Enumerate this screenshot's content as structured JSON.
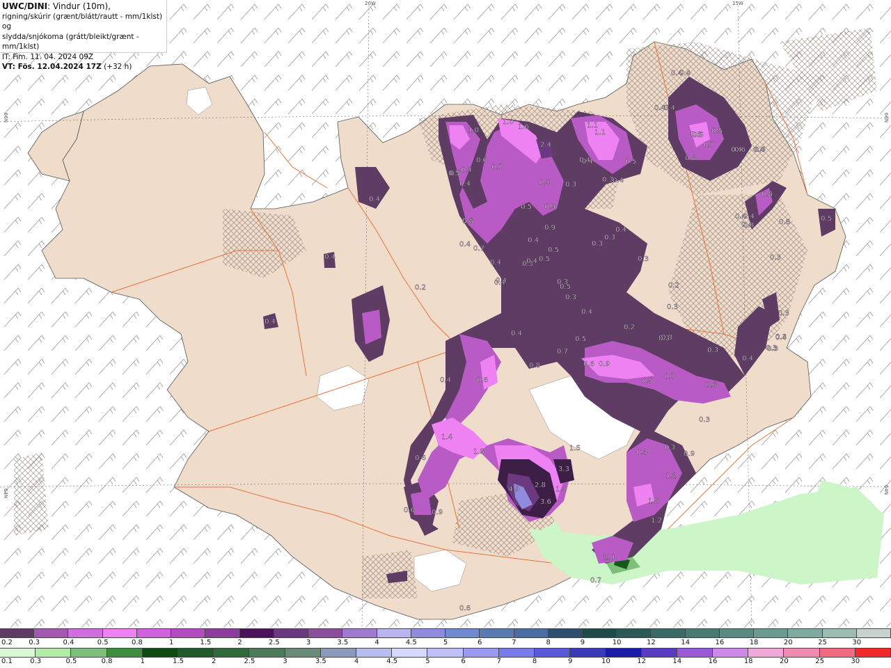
{
  "title": {
    "model": "UWC/DINI",
    "line1": ": Vindur (10m),",
    "line2": "rigning/skúrir (grænt/blátt/rautt - mm/1klst) og",
    "line3": "slydda/snjókoma (grátt/bleikt/grænt - mm/1klst)",
    "it": "IT: Fim. 11. 04. 2024 09Z",
    "vt_label": "VT: Fös. 12.04.2024 17Z",
    "vt_offset": " (+32 h)"
  },
  "grid_labels": {
    "top_20w": "20W",
    "top_15w": "15W",
    "left_66n": "66N",
    "right_66n": "66N",
    "left_64n": "64N",
    "right_64n": "64N"
  },
  "colors": {
    "land": "#efdccb",
    "sea": "#ffffff",
    "roads": "#e8743c",
    "wind_barbs": "#8a8a8a",
    "snow_light": "#5e3c63",
    "snow_mid": "#b95bc4",
    "snow_bright": "#ee82f2",
    "snow_heavy": "#3c1e47",
    "snow_peak": "#8f8ce0",
    "rain_light": "#ccf5c8",
    "rain_mid": "#7dbf7b",
    "rain_heavy": "#14581a"
  },
  "snow_scale": {
    "labels": [
      "0.2",
      "0.3",
      "0.4",
      "0.5",
      "0.8",
      "1",
      "1.5",
      "2",
      "2.5",
      "3",
      "3.5",
      "4",
      "4.5",
      "5",
      "6",
      "7",
      "8",
      "9",
      "10",
      "12",
      "14",
      "16",
      "18",
      "20",
      "25",
      "30"
    ],
    "colors": [
      "#5e3c63",
      "#a15ab0",
      "#d06ee0",
      "#ee82f2",
      "#d060de",
      "#b24cc0",
      "#8c3c9c",
      "#4a1058",
      "#6b3a7e",
      "#8a4f9a",
      "#a07ad0",
      "#b9b3ee",
      "#8f8ce0",
      "#6f8ad0",
      "#5a7ab2",
      "#4b6ca0",
      "#2e4e6e",
      "#1f4a4a",
      "#2b5a56",
      "#3a6a66",
      "#4a7a74",
      "#5a8a82",
      "#6a9a90",
      "#80aaa0",
      "#9cbbb2",
      "#c8d2cf"
    ]
  },
  "rain_scale": {
    "labels": [
      "0.1",
      "0.3",
      "0.5",
      "0.8",
      "1",
      "1.5",
      "2",
      "2.5",
      "3",
      "3.5",
      "4",
      "4.5",
      "5",
      "6",
      "7",
      "8",
      "9",
      "10",
      "12",
      "14",
      "16",
      "18",
      "20",
      "25",
      "30"
    ],
    "colors": [
      "#d9f8d4",
      "#b2eaa8",
      "#7dbf7b",
      "#3e8e40",
      "#0d4a12",
      "#1f5a2a",
      "#2f6a3a",
      "#4a7a5a",
      "#6a8a7a",
      "#8a9ab8",
      "#b8bcec",
      "#d8d8ff",
      "#c0c0f8",
      "#9a9af0",
      "#7a7aea",
      "#5858d8",
      "#3a3ab8",
      "#1a1aa8",
      "#5a3ac0",
      "#9a5ad8",
      "#d088e8",
      "#f0a8d8",
      "#f08ab0",
      "#f06a80",
      "#f02a2a"
    ]
  },
  "value_labels": [
    {
      "text": "1.0"
    },
    {
      "text": "1.0"
    },
    {
      "text": "1.6"
    },
    {
      "text": "1.1"
    },
    {
      "text": "1.1"
    },
    {
      "text": "2.4"
    },
    {
      "text": "0.4"
    },
    {
      "text": "0.4"
    },
    {
      "text": "0.4"
    },
    {
      "text": "0.6"
    },
    {
      "text": "0.5"
    },
    {
      "text": "0.7"
    },
    {
      "text": "0.6"
    },
    {
      "text": "0.4"
    },
    {
      "text": "0.3"
    },
    {
      "text": "0.5"
    },
    {
      "text": "0.4"
    },
    {
      "text": "0.9"
    },
    {
      "text": "0.4"
    },
    {
      "text": "0.5"
    },
    {
      "text": "0.4"
    },
    {
      "text": "0.2"
    },
    {
      "text": "0.4"
    },
    {
      "text": "0.4"
    },
    {
      "text": "0.3"
    },
    {
      "text": "0.3"
    },
    {
      "text": "0.5"
    },
    {
      "text": "0.4"
    },
    {
      "text": "0.4"
    },
    {
      "text": "0.3"
    },
    {
      "text": "0.6"
    },
    {
      "text": "0.8"
    },
    {
      "text": "0.4"
    },
    {
      "text": "0.6"
    },
    {
      "text": "0.9"
    },
    {
      "text": "0.5"
    },
    {
      "text": "0.9"
    },
    {
      "text": "0.7"
    },
    {
      "text": "0.4"
    },
    {
      "text": "0.7"
    },
    {
      "text": "0.5"
    },
    {
      "text": "0.4"
    },
    {
      "text": "0.4"
    },
    {
      "text": "0.5"
    },
    {
      "text": "0.3"
    },
    {
      "text": "0.4"
    },
    {
      "text": "0.3"
    },
    {
      "text": "0.3"
    },
    {
      "text": "0.3"
    },
    {
      "text": "0.4"
    },
    {
      "text": "0.4"
    },
    {
      "text": "0.5"
    },
    {
      "text": "0.3"
    },
    {
      "text": "0.3"
    },
    {
      "text": "0.4"
    },
    {
      "text": "0.4"
    },
    {
      "text": "0.4"
    },
    {
      "text": "0.3"
    },
    {
      "text": "0.2"
    },
    {
      "text": "0.3"
    },
    {
      "text": "0.3"
    },
    {
      "text": "0.3"
    },
    {
      "text": "0.5"
    },
    {
      "text": "0.7"
    },
    {
      "text": "0.6"
    },
    {
      "text": "0.6"
    },
    {
      "text": "0.8"
    },
    {
      "text": "0.4"
    },
    {
      "text": "0.8"
    },
    {
      "text": "0.6"
    },
    {
      "text": "0.5"
    },
    {
      "text": "0.7"
    },
    {
      "text": "0.6"
    },
    {
      "text": "0.4"
    },
    {
      "text": "0.3"
    },
    {
      "text": "0.3"
    },
    {
      "text": "1.4"
    },
    {
      "text": "1.5"
    },
    {
      "text": "0.6"
    },
    {
      "text": "1.5"
    },
    {
      "text": "3.3"
    },
    {
      "text": "4.9"
    },
    {
      "text": "2.8"
    },
    {
      "text": "1.4"
    },
    {
      "text": "3.6"
    },
    {
      "text": "0.6"
    },
    {
      "text": "0.9"
    },
    {
      "text": "0.3"
    },
    {
      "text": "1.2"
    },
    {
      "text": "0.9"
    },
    {
      "text": "1.8"
    },
    {
      "text": "1.2"
    },
    {
      "text": "2.0"
    },
    {
      "text": "0.7"
    },
    {
      "text": "0.6"
    },
    {
      "text": "0.4"
    },
    {
      "text": "0.3"
    },
    {
      "text": "0.4"
    },
    {
      "text": "0.2"
    },
    {
      "text": "0.4"
    },
    {
      "text": "0.4"
    },
    {
      "text": "0.4"
    },
    {
      "text": "0.6"
    },
    {
      "text": "0.5"
    },
    {
      "text": "0.3"
    },
    {
      "text": "0.6"
    },
    {
      "text": "0.8"
    },
    {
      "text": "0.4"
    },
    {
      "text": "0.4"
    },
    {
      "text": "0.3"
    },
    {
      "text": "0.3"
    },
    {
      "text": "0.4"
    },
    {
      "text": "0.5"
    },
    {
      "text": "0.4"
    }
  ]
}
